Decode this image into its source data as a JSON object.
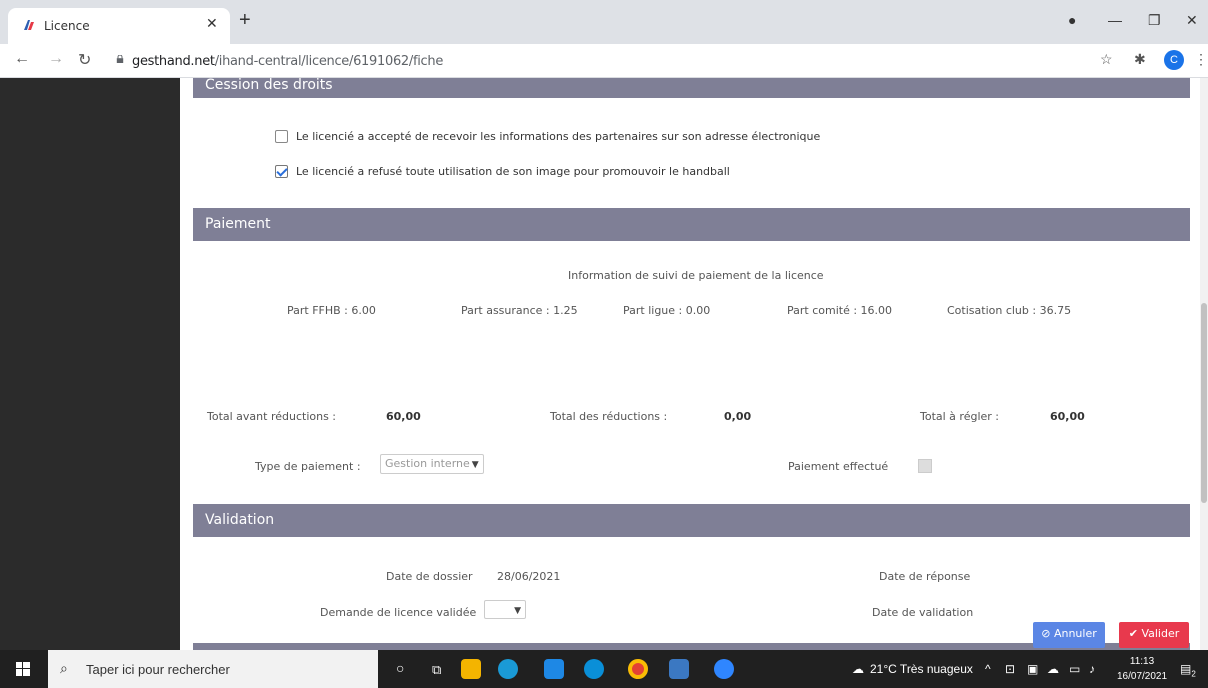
{
  "browser": {
    "tab_title": "Licence",
    "url_host": "gesthand.net",
    "url_path": "/ihand-central/licence/6191062/fiche",
    "profile_initial": "C"
  },
  "sections": {
    "cession_title": "Cession des droits",
    "paiement_title": "Paiement",
    "validation_title": "Validation"
  },
  "cession": {
    "partners_label": "Le licencié a accepté de recevoir les informations des partenaires sur son adresse électronique",
    "partners_checked": false,
    "image_label": "Le licencié a refusé toute utilisation de son image pour promouvoir le handball",
    "image_checked": true
  },
  "paiement": {
    "info_title": "Information de suivi de paiement de la licence",
    "part_ffhb": "Part FFHB : 6.00",
    "part_assurance": "Part assurance : 1.25",
    "part_ligue": "Part ligue : 0.00",
    "part_comite": "Part comité : 16.00",
    "cotisation_club": "Cotisation club : 36.75",
    "total_avant_label": "Total avant réductions :",
    "total_avant_value": "60,00",
    "total_reductions_label": "Total des réductions :",
    "total_reductions_value": "0,00",
    "total_regler_label": "Total à régler :",
    "total_regler_value": "60,00",
    "type_label": "Type de paiement :",
    "type_value": "Gestion interne",
    "effectue_label": "Paiement effectué"
  },
  "validation": {
    "date_dossier_label": "Date de dossier",
    "date_dossier_value": "28/06/2021",
    "date_reponse_label": "Date de réponse",
    "demande_label": "Demande de licence validée",
    "date_validation_label": "Date de validation"
  },
  "actions": {
    "cancel_label": "Annuler",
    "validate_label": "Valider"
  },
  "taskbar": {
    "search_placeholder": "Taper ici pour rechercher",
    "weather": "21°C  Très nuageux",
    "time": "11:13",
    "date": "16/07/2021",
    "notif_count": "2"
  },
  "colors": {
    "section_header": "#7f7f96",
    "left_rail": "#2b2b2b",
    "cancel_button": "#5b86e5",
    "validate_button": "#e8394d"
  }
}
